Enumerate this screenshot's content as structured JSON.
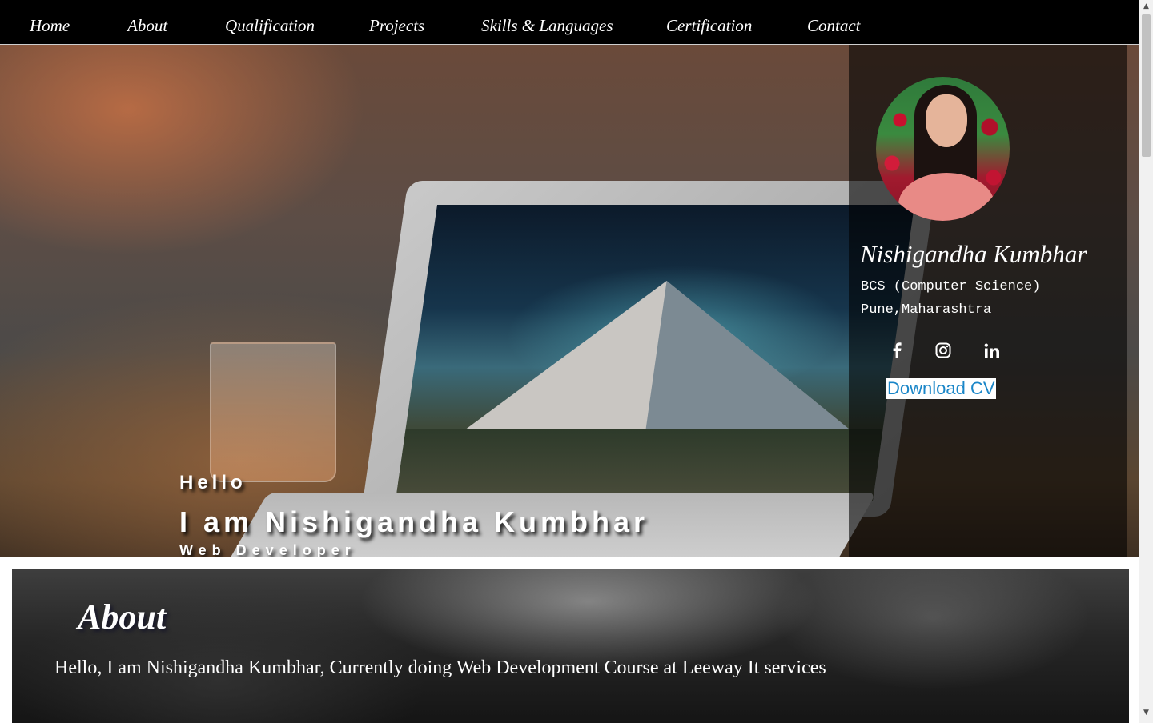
{
  "nav": {
    "items": [
      {
        "label": "Home"
      },
      {
        "label": "About"
      },
      {
        "label": "Qualification"
      },
      {
        "label": "Projects"
      },
      {
        "label": "Skills & Languages"
      },
      {
        "label": "Certification"
      },
      {
        "label": "Contact"
      }
    ]
  },
  "hero": {
    "greeting": "Hello",
    "headline": "I am Nishigandha Kumbhar",
    "role": "Web Developer"
  },
  "profile": {
    "name": "Nishigandha Kumbhar",
    "degree": "BCS (Computer Science)",
    "location": "Pune,Maharashtra",
    "socials": [
      {
        "icon": "facebook-icon"
      },
      {
        "icon": "instagram-icon"
      },
      {
        "icon": "linkedin-icon"
      }
    ],
    "download_label": "Download CV"
  },
  "about": {
    "title": "About",
    "text": "Hello, I am Nishigandha Kumbhar, Currently doing Web Development Course at Leeway It services"
  },
  "colors": {
    "nav_bg": "#000000",
    "link_blue": "#1a86c8",
    "panel_overlay": "rgba(0,0,0,0.58)"
  }
}
